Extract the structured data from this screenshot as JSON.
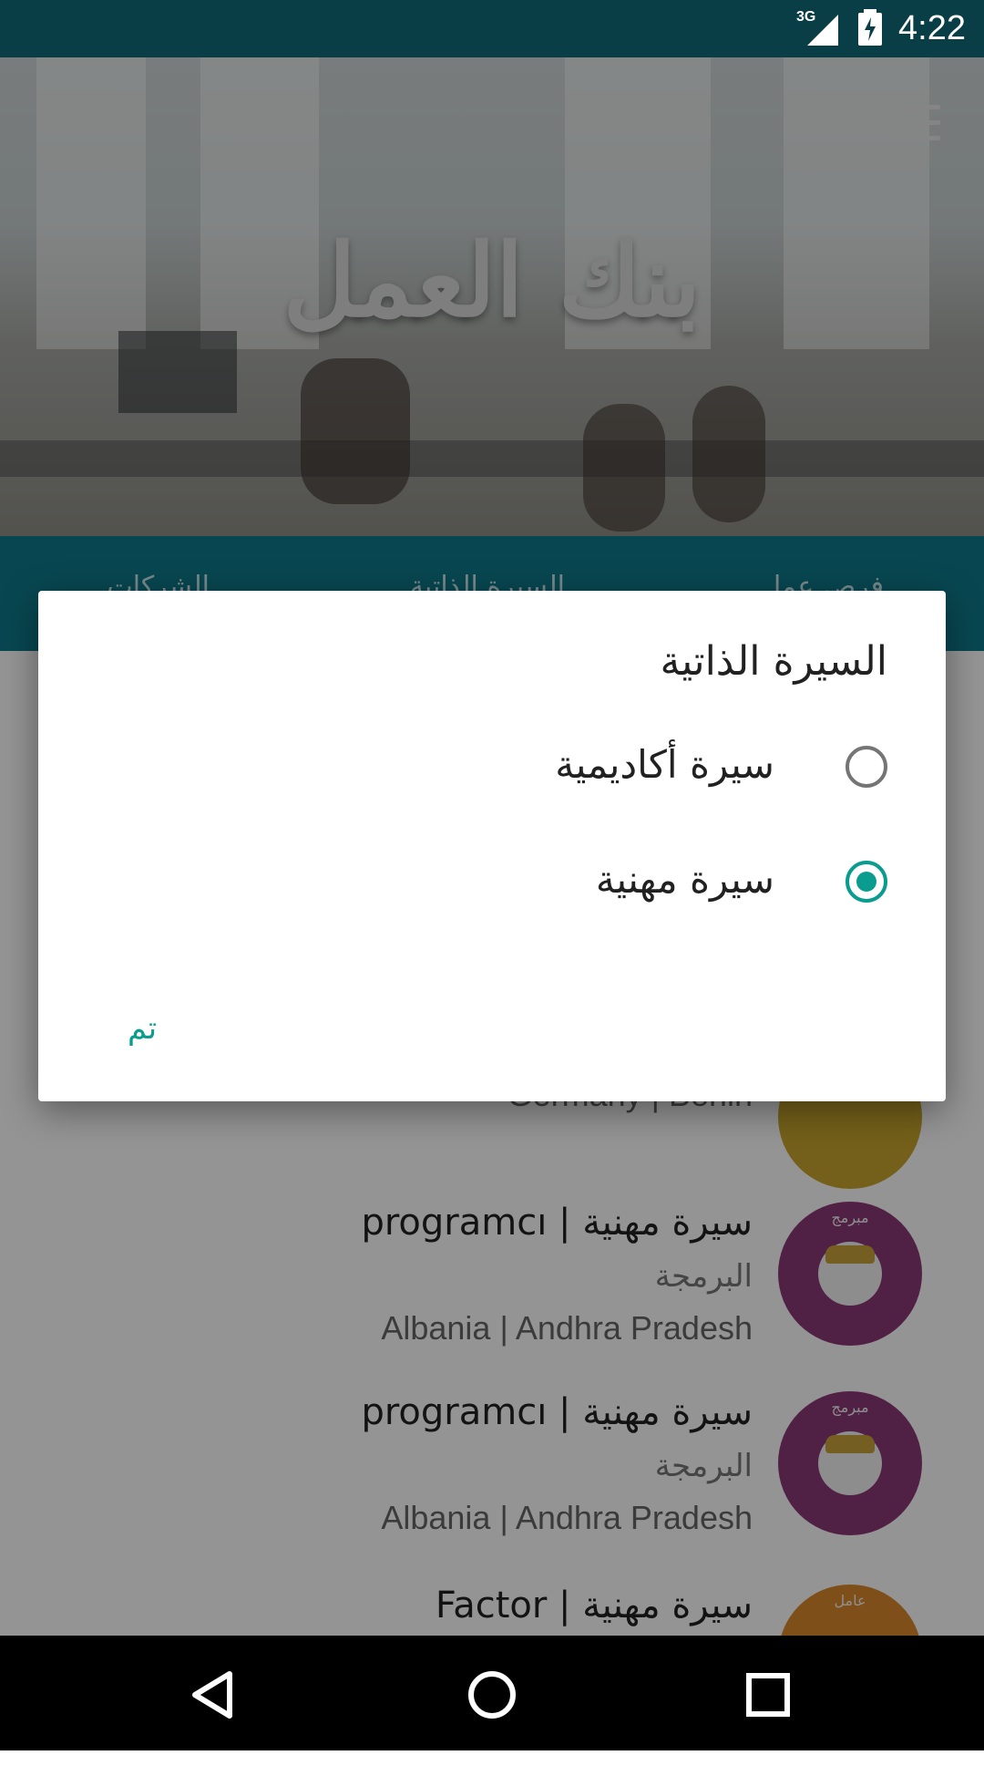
{
  "status_bar": {
    "network": "3G",
    "time": "4:22"
  },
  "header": {
    "app_title": "بنك العمل",
    "menu_icon": "hamburger-menu-icon"
  },
  "tabs": [
    {
      "label": "فرص عمل"
    },
    {
      "label": "السيرة الذاتية"
    },
    {
      "label": "الشركات"
    }
  ],
  "list": {
    "items": [
      {
        "title": "",
        "subtitle": "",
        "location": "Germany | Berlin",
        "avatar_color": "#c9a62e",
        "avatar_tag": ""
      },
      {
        "title": "سيرة مهنية | programcı",
        "subtitle": "البرمجة",
        "location": "Albania | Andhra Pradesh",
        "avatar_color": "#8a3a78",
        "avatar_tag": "مبرمج"
      },
      {
        "title": "سيرة مهنية | programcı",
        "subtitle": "البرمجة",
        "location": "Albania | Andhra Pradesh",
        "avatar_color": "#8a3a78",
        "avatar_tag": "مبرمج"
      },
      {
        "title": "سيرة مهنية | Factor",
        "subtitle": "",
        "location": "",
        "avatar_color": "#d9882b",
        "avatar_tag": "عامل"
      }
    ]
  },
  "dialog": {
    "title": "السيرة الذاتية",
    "options": [
      {
        "label": "سيرة أكاديمية",
        "selected": false
      },
      {
        "label": "سيرة مهنية",
        "selected": true
      }
    ],
    "confirm_label": "تم"
  },
  "colors": {
    "status_bar": "#0a3e47",
    "tab_bar": "#0e7b8c",
    "accent": "#0a9d8f"
  },
  "nav_bar": {
    "back_icon": "back-triangle-icon",
    "home_icon": "home-circle-icon",
    "recents_icon": "recents-square-icon"
  }
}
